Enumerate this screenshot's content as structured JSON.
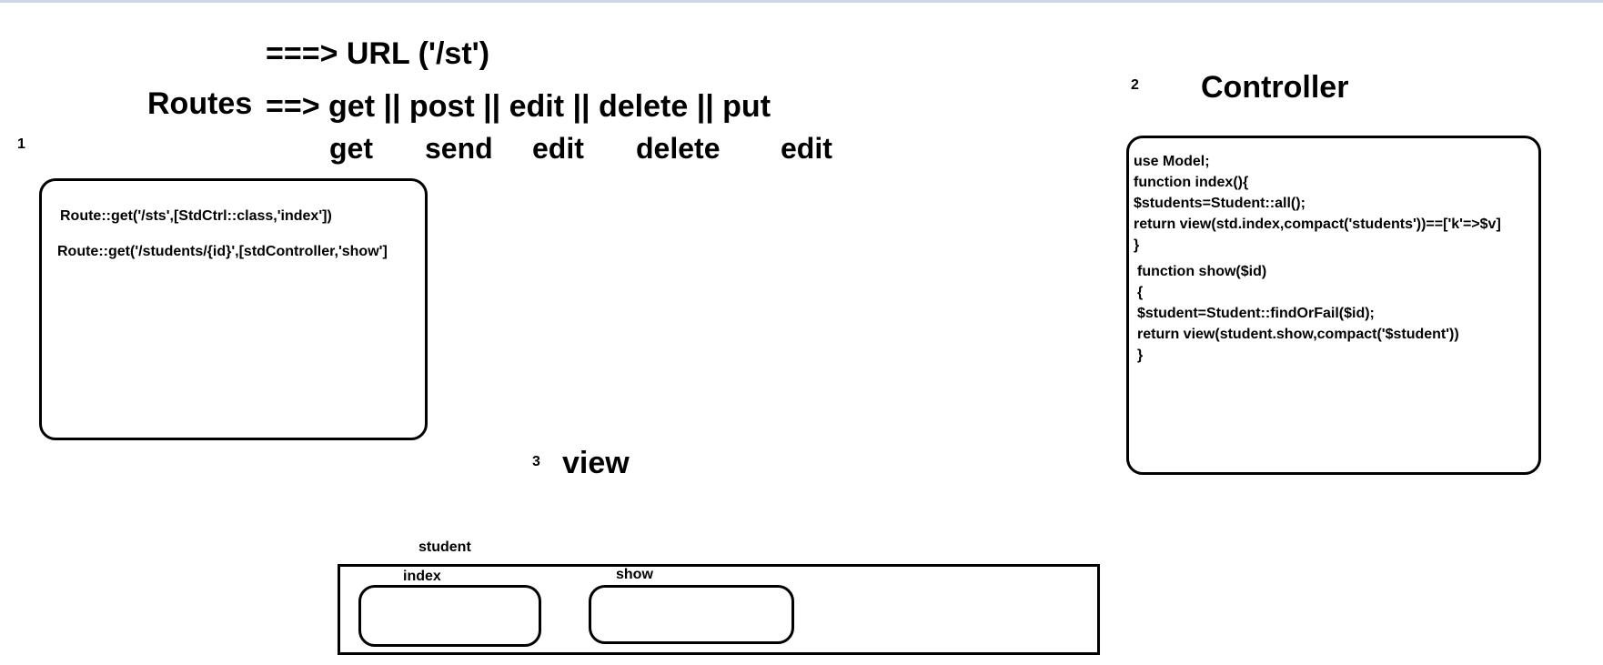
{
  "routes": {
    "url_line": "===> URL ('/st')",
    "title": "Routes",
    "methods_line": "==> get  || post || edit || delete || put",
    "actions": [
      "get",
      "send",
      "edit",
      "delete",
      "edit"
    ],
    "number": "1",
    "code": [
      "Route::get('/sts',[StdCtrl::class,'index'])",
      "Route::get('/students/{id}',[stdController,'show']"
    ]
  },
  "controller": {
    "number": "2",
    "title": "Controller",
    "code": [
      "use Model;",
      "function index(){",
      "$students=Student::all();",
      "return view(std.index,compact('students'))==['k'=>$v]",
      "}",
      "function show($id)",
      "{",
      "$student=Student::findOrFail($id);",
      "return view(student.show,compact('$student'))",
      "}"
    ]
  },
  "view": {
    "number": "3",
    "title": "view",
    "folder_label": "student",
    "index_label": "index",
    "show_label": "show"
  }
}
